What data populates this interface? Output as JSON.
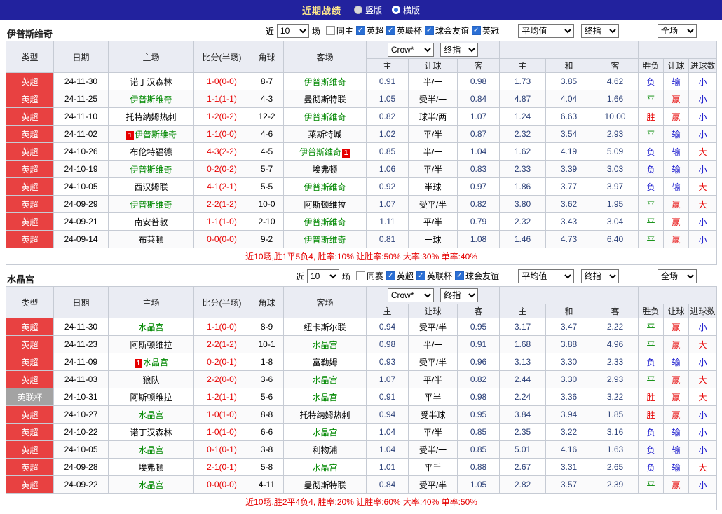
{
  "topbar": {
    "title": "近期战绩",
    "layout_options": [
      {
        "label": "竖版",
        "selected": false
      },
      {
        "label": "横版",
        "selected": true
      }
    ]
  },
  "table_headers": {
    "col_type": "类型",
    "col_date": "日期",
    "col_home": "主场",
    "col_score": "比分(半场)",
    "col_corner": "角球",
    "col_away": "客场",
    "odds_sub": [
      "主",
      "让球",
      "客"
    ],
    "avg_sub": [
      "主",
      "和",
      "客"
    ],
    "result_sub": [
      "胜负",
      "让球",
      "进球数"
    ]
  },
  "selects": {
    "odds_company": "Crow*",
    "odds_time": "终指",
    "avg_label": "平均值",
    "avg_time": "终指",
    "scope": "全场"
  },
  "colors": {
    "topbar_bg": "#22229e",
    "topbar_title": "#ffe98c",
    "score": "#e60000",
    "focus_team": "#008800",
    "odds_text": "#2a3f77",
    "league": {
      "英超": "#e84141",
      "英联杯": "#a3a3a3"
    },
    "outcome": {
      "胜": "#e60000",
      "平": "#008800",
      "负": "#1414cc",
      "赢": "#e60000",
      "输": "#1414cc",
      "大": "#e60000",
      "小": "#1414cc"
    }
  },
  "tables": [
    {
      "team": "伊普斯维奇",
      "filters": {
        "prefix": "近",
        "count": "10",
        "suffix": "场",
        "checkboxes": [
          {
            "label": "同主",
            "checked": false
          },
          {
            "label": "英超",
            "checked": true
          },
          {
            "label": "英联杯",
            "checked": true
          },
          {
            "label": "球会友谊",
            "checked": true
          },
          {
            "label": "英冠",
            "checked": true
          }
        ]
      },
      "rows": [
        {
          "league": "英超",
          "date": "24-11-30",
          "home": "诺丁汉森林",
          "score": "1-0(0-0)",
          "corner": "8-7",
          "away": "伊普斯维奇",
          "odds": [
            "0.91",
            "半/一",
            "0.98"
          ],
          "avg": [
            "1.73",
            "3.85",
            "4.62"
          ],
          "outcome": [
            "负",
            "输",
            "小"
          ]
        },
        {
          "league": "英超",
          "date": "24-11-25",
          "home": "伊普斯维奇",
          "score": "1-1(1-1)",
          "corner": "4-3",
          "away": "曼彻斯特联",
          "odds": [
            "1.05",
            "受半/一",
            "0.84"
          ],
          "avg": [
            "4.87",
            "4.04",
            "1.66"
          ],
          "outcome": [
            "平",
            "赢",
            "小"
          ]
        },
        {
          "league": "英超",
          "date": "24-11-10",
          "home": "托特纳姆热刺",
          "score": "1-2(0-2)",
          "corner": "12-2",
          "away": "伊普斯维奇",
          "odds": [
            "0.82",
            "球半/两",
            "1.07"
          ],
          "avg": [
            "1.24",
            "6.63",
            "10.00"
          ],
          "outcome": [
            "胜",
            "赢",
            "小"
          ]
        },
        {
          "league": "英超",
          "date": "24-11-02",
          "home": "伊普斯维奇",
          "home_card": "1",
          "home_card_pos": "left",
          "score": "1-1(0-0)",
          "corner": "4-6",
          "away": "莱斯特城",
          "odds": [
            "1.02",
            "平/半",
            "0.87"
          ],
          "avg": [
            "2.32",
            "3.54",
            "2.93"
          ],
          "outcome": [
            "平",
            "输",
            "小"
          ]
        },
        {
          "league": "英超",
          "date": "24-10-26",
          "home": "布伦特福德",
          "score": "4-3(2-2)",
          "corner": "4-5",
          "away": "伊普斯维奇",
          "away_card": "1",
          "away_card_pos": "right",
          "odds": [
            "0.85",
            "半/一",
            "1.04"
          ],
          "avg": [
            "1.62",
            "4.19",
            "5.09"
          ],
          "outcome": [
            "负",
            "输",
            "大"
          ]
        },
        {
          "league": "英超",
          "date": "24-10-19",
          "home": "伊普斯维奇",
          "score": "0-2(0-2)",
          "corner": "5-7",
          "away": "埃弗顿",
          "odds": [
            "1.06",
            "平/半",
            "0.83"
          ],
          "avg": [
            "2.33",
            "3.39",
            "3.03"
          ],
          "outcome": [
            "负",
            "输",
            "小"
          ]
        },
        {
          "league": "英超",
          "date": "24-10-05",
          "home": "西汉姆联",
          "score": "4-1(2-1)",
          "corner": "5-5",
          "away": "伊普斯维奇",
          "odds": [
            "0.92",
            "半球",
            "0.97"
          ],
          "avg": [
            "1.86",
            "3.77",
            "3.97"
          ],
          "outcome": [
            "负",
            "输",
            "大"
          ]
        },
        {
          "league": "英超",
          "date": "24-09-29",
          "home": "伊普斯维奇",
          "score": "2-2(1-2)",
          "corner": "10-0",
          "away": "阿斯顿维拉",
          "odds": [
            "1.07",
            "受平/半",
            "0.82"
          ],
          "avg": [
            "3.80",
            "3.62",
            "1.95"
          ],
          "outcome": [
            "平",
            "赢",
            "大"
          ]
        },
        {
          "league": "英超",
          "date": "24-09-21",
          "home": "南安普敦",
          "score": "1-1(1-0)",
          "corner": "2-10",
          "away": "伊普斯维奇",
          "odds": [
            "1.11",
            "平/半",
            "0.79"
          ],
          "avg": [
            "2.32",
            "3.43",
            "3.04"
          ],
          "outcome": [
            "平",
            "赢",
            "小"
          ]
        },
        {
          "league": "英超",
          "date": "24-09-14",
          "home": "布莱顿",
          "score": "0-0(0-0)",
          "corner": "9-2",
          "away": "伊普斯维奇",
          "odds": [
            "0.81",
            "一球",
            "1.08"
          ],
          "avg": [
            "1.46",
            "4.73",
            "6.40"
          ],
          "outcome": [
            "平",
            "赢",
            "小"
          ]
        }
      ],
      "summary": "近10场,胜1平5负4, 胜率:10% 让胜率:50% 大率:30% 单率:40%"
    },
    {
      "team": "水晶宫",
      "filters": {
        "prefix": "近",
        "count": "10",
        "suffix": "场",
        "checkboxes": [
          {
            "label": "同赛",
            "checked": false
          },
          {
            "label": "英超",
            "checked": true
          },
          {
            "label": "英联杯",
            "checked": true
          },
          {
            "label": "球会友谊",
            "checked": true
          }
        ]
      },
      "rows": [
        {
          "league": "英超",
          "date": "24-11-30",
          "home": "水晶宫",
          "score": "1-1(0-0)",
          "corner": "8-9",
          "away": "纽卡斯尔联",
          "odds": [
            "0.94",
            "受平/半",
            "0.95"
          ],
          "avg": [
            "3.17",
            "3.47",
            "2.22"
          ],
          "outcome": [
            "平",
            "赢",
            "小"
          ]
        },
        {
          "league": "英超",
          "date": "24-11-23",
          "home": "阿斯顿维拉",
          "score": "2-2(1-2)",
          "corner": "10-1",
          "away": "水晶宫",
          "odds": [
            "0.98",
            "半/一",
            "0.91"
          ],
          "avg": [
            "1.68",
            "3.88",
            "4.96"
          ],
          "outcome": [
            "平",
            "赢",
            "大"
          ]
        },
        {
          "league": "英超",
          "date": "24-11-09",
          "home": "水晶宫",
          "home_card": "1",
          "home_card_pos": "left",
          "score": "0-2(0-1)",
          "corner": "1-8",
          "away": "富勒姆",
          "odds": [
            "0.93",
            "受平/半",
            "0.96"
          ],
          "avg": [
            "3.13",
            "3.30",
            "2.33"
          ],
          "outcome": [
            "负",
            "输",
            "小"
          ]
        },
        {
          "league": "英超",
          "date": "24-11-03",
          "home": "狼队",
          "score": "2-2(0-0)",
          "corner": "3-6",
          "away": "水晶宫",
          "odds": [
            "1.07",
            "平/半",
            "0.82"
          ],
          "avg": [
            "2.44",
            "3.30",
            "2.93"
          ],
          "outcome": [
            "平",
            "赢",
            "大"
          ]
        },
        {
          "league": "英联杯",
          "date": "24-10-31",
          "home": "阿斯顿维拉",
          "score": "1-2(1-1)",
          "corner": "5-6",
          "away": "水晶宫",
          "odds": [
            "0.91",
            "平半",
            "0.98"
          ],
          "avg": [
            "2.24",
            "3.36",
            "3.22"
          ],
          "outcome": [
            "胜",
            "赢",
            "大"
          ]
        },
        {
          "league": "英超",
          "date": "24-10-27",
          "home": "水晶宫",
          "score": "1-0(1-0)",
          "corner": "8-8",
          "away": "托特纳姆热刺",
          "odds": [
            "0.94",
            "受半球",
            "0.95"
          ],
          "avg": [
            "3.84",
            "3.94",
            "1.85"
          ],
          "outcome": [
            "胜",
            "赢",
            "小"
          ]
        },
        {
          "league": "英超",
          "date": "24-10-22",
          "home": "诺丁汉森林",
          "score": "1-0(1-0)",
          "corner": "6-6",
          "away": "水晶宫",
          "odds": [
            "1.04",
            "平/半",
            "0.85"
          ],
          "avg": [
            "2.35",
            "3.22",
            "3.16"
          ],
          "outcome": [
            "负",
            "输",
            "小"
          ]
        },
        {
          "league": "英超",
          "date": "24-10-05",
          "home": "水晶宫",
          "score": "0-1(0-1)",
          "corner": "3-8",
          "away": "利物浦",
          "odds": [
            "1.04",
            "受半/一",
            "0.85"
          ],
          "avg": [
            "5.01",
            "4.16",
            "1.63"
          ],
          "outcome": [
            "负",
            "输",
            "小"
          ]
        },
        {
          "league": "英超",
          "date": "24-09-28",
          "home": "埃弗顿",
          "score": "2-1(0-1)",
          "corner": "5-8",
          "away": "水晶宫",
          "odds": [
            "1.01",
            "平手",
            "0.88"
          ],
          "avg": [
            "2.67",
            "3.31",
            "2.65"
          ],
          "outcome": [
            "负",
            "输",
            "大"
          ]
        },
        {
          "league": "英超",
          "date": "24-09-22",
          "home": "水晶宫",
          "score": "0-0(0-0)",
          "corner": "4-11",
          "away": "曼彻斯特联",
          "odds": [
            "0.84",
            "受平/半",
            "1.05"
          ],
          "avg": [
            "2.82",
            "3.57",
            "2.39"
          ],
          "outcome": [
            "平",
            "赢",
            "小"
          ]
        }
      ],
      "summary": "近10场,胜2平4负4, 胜率:20% 让胜率:60% 大率:40% 单率:50%"
    }
  ]
}
